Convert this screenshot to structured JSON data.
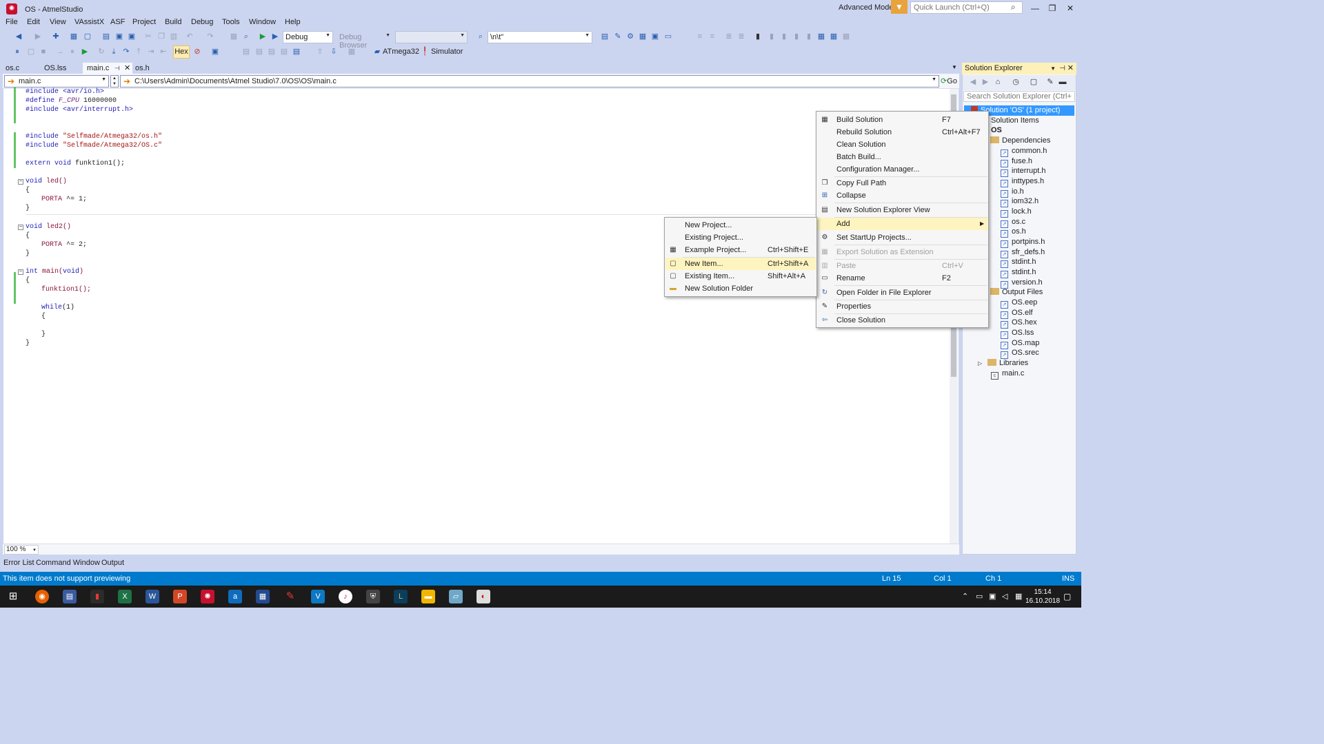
{
  "window": {
    "title": "OS - AtmelStudio",
    "advanced_mode": "Advanced Mode",
    "quick_launch_placeholder": "Quick Launch (Ctrl+Q)"
  },
  "menu": [
    "File",
    "Edit",
    "View",
    "VAssistX",
    "ASF",
    "Project",
    "Build",
    "Debug",
    "Tools",
    "Window",
    "Help"
  ],
  "toolbar": {
    "config": "Debug",
    "debug_browser": "Debug Browser",
    "find_value": "\\n\\t\"",
    "hex": "Hex",
    "device": "ATmega32",
    "tool": "Simulator"
  },
  "tabs": [
    {
      "label": "os.c"
    },
    {
      "label": "OS.lss"
    },
    {
      "label": "main.c"
    },
    {
      "label": "os.h"
    }
  ],
  "nav": {
    "file": "main.c",
    "path": "C:\\Users\\Admin\\Documents\\Atmel Studio\\7.0\\OS\\OS\\main.c",
    "go": "Go"
  },
  "code": {
    "l1": "#include <avr/io.h>",
    "l2a": "#define ",
    "l2b": "F_CPU",
    "l2c": " 16000000",
    "l3": "#include <avr/interrupt.h>",
    "l4a": "#include ",
    "l4b": "\"Selfmade/Atmega32/os.h\"",
    "l5a": "#include ",
    "l5b": "\"Selfmade/Atmega32/OS.c\"",
    "l6a": "extern void ",
    "l6b": "funktion1();",
    "l7a": "void ",
    "l7b": "led()",
    "brace_open": "{",
    "brace_close": "}",
    "l8a": "PORTA",
    "l8b": " ^= 1;",
    "l9a": "void ",
    "l9b": "led2()",
    "l10a": "PORTA",
    "l10b": " ^= 2;",
    "l11a": "int ",
    "l11b": "main(",
    "l11c": "void",
    "l11d": ")",
    "l12": "funktion1();",
    "l13a": "while",
    "l13b": "(1)"
  },
  "zoom": "100 %",
  "bottom_tabs": [
    "Error List",
    "Command Window",
    "Output"
  ],
  "status": {
    "message": "This item does not support previewing",
    "ln": "Ln 15",
    "col": "Col 1",
    "ch": "Ch 1",
    "ins": "INS"
  },
  "solution_explorer": {
    "title": "Solution Explorer",
    "search_placeholder": "Search Solution Explorer (Ctrl+;)",
    "solution": "Solution 'OS' (1 project)",
    "items": [
      "Solution Items",
      "OS",
      "Dependencies",
      "common.h",
      "fuse.h",
      "interrupt.h",
      "inttypes.h",
      "io.h",
      "iom32.h",
      "lock.h",
      "os.c",
      "os.h",
      "portpins.h",
      "sfr_defs.h",
      "stdint.h",
      "stdint.h",
      "version.h",
      "Output Files",
      "OS.eep",
      "OS.elf",
      "OS.hex",
      "OS.lss",
      "OS.map",
      "OS.srec",
      "Libraries",
      "main.c"
    ]
  },
  "context_menu": {
    "build": {
      "label": "Build Solution",
      "sc": "F7"
    },
    "rebuild": {
      "label": "Rebuild Solution",
      "sc": "Ctrl+Alt+F7"
    },
    "clean": {
      "label": "Clean Solution"
    },
    "batch": {
      "label": "Batch Build..."
    },
    "config": {
      "label": "Configuration Manager..."
    },
    "copy_path": {
      "label": "Copy Full Path"
    },
    "collapse": {
      "label": "Collapse"
    },
    "new_view": {
      "label": "New Solution Explorer View"
    },
    "add": {
      "label": "Add"
    },
    "startup": {
      "label": "Set StartUp Projects..."
    },
    "export": {
      "label": "Export Solution as Extension"
    },
    "paste": {
      "label": "Paste",
      "sc": "Ctrl+V"
    },
    "rename": {
      "label": "Rename",
      "sc": "F2"
    },
    "open_folder": {
      "label": "Open Folder in File Explorer"
    },
    "properties": {
      "label": "Properties"
    },
    "close": {
      "label": "Close Solution"
    }
  },
  "add_submenu": {
    "new_project": {
      "label": "New Project..."
    },
    "existing_project": {
      "label": "Existing Project..."
    },
    "example_project": {
      "label": "Example Project...",
      "sc": "Ctrl+Shift+E"
    },
    "new_item": {
      "label": "New Item...",
      "sc": "Ctrl+Shift+A"
    },
    "existing_item": {
      "label": "Existing Item...",
      "sc": "Shift+Alt+A"
    },
    "new_folder": {
      "label": "New Solution Folder"
    }
  },
  "taskbar": {
    "time": "15:14",
    "date": "16.10.2018"
  },
  "colors": {
    "status_bar": "#007acc",
    "chrome": "#ccd5f0",
    "highlight": "#fdf4bf",
    "selection": "#3399ff"
  }
}
